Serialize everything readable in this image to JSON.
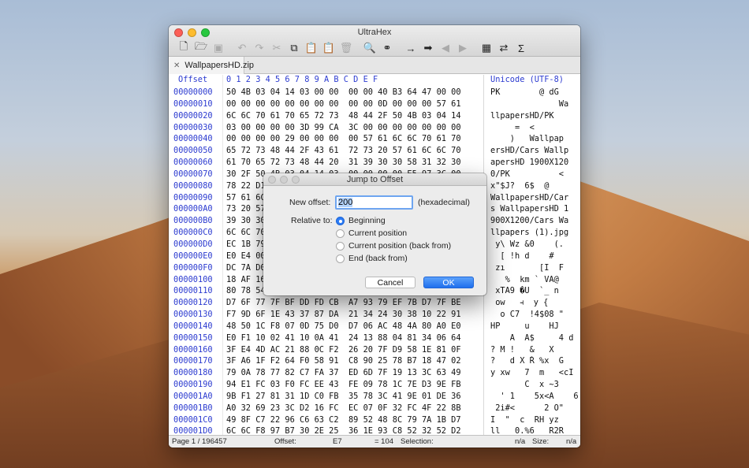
{
  "window": {
    "title": "UltraHex"
  },
  "toolbar": {
    "icons": [
      "new-document-icon",
      "open-folder-icon",
      "save-icon",
      "undo-icon",
      "redo-icon",
      "cut-icon",
      "copy-icon",
      "paste-icon",
      "paste-special-icon",
      "delete-icon",
      "find-icon",
      "binoculars-icon",
      "go-forward-icon",
      "jump-icon",
      "previous-icon",
      "next-icon",
      "columns-icon",
      "swap-icon",
      "sum-icon"
    ]
  },
  "tab": {
    "label": "WallpapersHD.zip"
  },
  "header": {
    "offset": "Offset",
    "hex_cols": "0  1  2  3  4  5  6  7   8  9  A  B  C  D  E  F",
    "unicode": "Unicode (UTF-8)"
  },
  "rows": [
    {
      "off": "00000000",
      "hex": "50 4B 03 04 14 03 00 00  00 00 40 B3 64 47 00 00",
      "txt": "PK        @ dG"
    },
    {
      "off": "00000010",
      "hex": "00 00 00 00 00 00 00 00  00 00 0D 00 00 00 57 61",
      "txt": "              Wa"
    },
    {
      "off": "00000020",
      "hex": "6C 6C 70 61 70 65 72 73  48 44 2F 50 4B 03 04 14",
      "txt": "llpapersHD/PK"
    },
    {
      "off": "00000030",
      "hex": "03 00 00 00 00 3D 99 CA  3C 00 00 00 00 00 00 00",
      "txt": "     =  <"
    },
    {
      "off": "00000040",
      "hex": "00 00 00 00 29 00 00 00  00 57 61 6C 6C 70 61 70",
      "txt": "    )   Wallpap"
    },
    {
      "off": "00000050",
      "hex": "65 72 73 48 44 2F 43 61  72 73 20 57 61 6C 6C 70",
      "txt": "ersHD/Cars Wallp"
    },
    {
      "off": "00000060",
      "hex": "61 70 65 72 73 48 44 20  31 39 30 30 58 31 32 30",
      "txt": "apersHD 1900X120"
    },
    {
      "off": "00000070",
      "hex": "30 2F 50 4B 03 04 14 03  00 00 00 00 E5 97 3C 00",
      "txt": "0/PK          <"
    },
    {
      "off": "00000080",
      "hex": "78 22 D1 3F 24 4A 3F 20  20 20 36 24 20 20 40 00",
      "txt": "x\"$J?  6$  @"
    },
    {
      "off": "00000090",
      "hex": "57 61 6C 6C 70 61 70 65  72 73 48 44 2F 43 61 72",
      "txt": "WallpapersHD/Car"
    },
    {
      "off": "000000A0",
      "hex": "73 20 57 61 6C 6C 70 61  70 65 72 73 48 44 20 31",
      "txt": "s WallpapersHD 1"
    },
    {
      "off": "000000B0",
      "hex": "39 30 30 58 31 32 30 30  2F 43 61 72 73 20 57 61",
      "txt": "900X1200/Cars Wa"
    },
    {
      "off": "000000C0",
      "hex": "6C 6C 70 61 70 65 72 73  20 28 31 29 2E 6A 70 67",
      "txt": "llpapers (1).jpg"
    },
    {
      "off": "000000D0",
      "hex": "EC 1B 79 5C 20 57 7A 20  26 30 20 20 20 20 28 2E",
      "txt": " y\\ Wz &0    (."
    },
    {
      "off": "000000E0",
      "hex": "E0 E4 00 5B 20 21 68 20  64 20 20 20 20 23 20 20",
      "txt": "  [ !h d    #"
    },
    {
      "off": "000000F0",
      "hex": "DC 7A D0 20 20 20 20 20  20 20 5B 49 20 20 46 20",
      "txt": " zı       [I  F"
    },
    {
      "off": "00000100",
      "hex": "18 AF 16 25 20 6B 6D 20  20 27 20 56 41 40 20 20",
      "txt": "   %  km ` VA@"
    },
    {
      "off": "00000110",
      "hex": "80 78 54 41 39 20 55 20  20 60 5F 20 6E 20 20 20",
      "txt": " xTA9 �U  `_ n"
    },
    {
      "off": "00000120",
      "hex": "D7 6F 77 7F BF DD FD CB  A7 93 79 EF 7B D7 7F BE",
      "txt": " ow   ⫞  y {"
    },
    {
      "off": "00000130",
      "hex": "F7 9D 6F 1E 43 37 87 DA  21 34 24 30 38 10 22 91",
      "txt": "  o C7  !4$08 \""
    },
    {
      "off": "00000140",
      "hex": "48 50 1C F8 07 0D 75 D0  D7 06 AC 48 4A 80 A0 E0",
      "txt": "HP     u    HJ"
    },
    {
      "off": "00000150",
      "hex": "E0 F1 10 02 41 10 0A 41  24 13 88 04 81 34 06 64",
      "txt": "    A  A$     4 d"
    },
    {
      "off": "00000160",
      "hex": "3F E4 4D AC 21 88 0C F2  26 20 7F D9 58 1E 81 0F",
      "txt": "? M !   &   X"
    },
    {
      "off": "00000170",
      "hex": "3F A6 1F F2 64 F0 58 91  C8 90 25 78 B7 18 47 02",
      "txt": "?   d X Ř %x  G"
    },
    {
      "off": "00000180",
      "hex": "79 0A 78 77 82 C7 FA 37  ED 6D 7F 19 13 3C 63 49",
      "txt": "y xw   7  m   <cI"
    },
    {
      "off": "00000190",
      "hex": "94 E1 FC 03 F0 FC EE 43  FE 09 78 1C 7E D3 9E FB",
      "txt": "       C  x ~Ӟ"
    },
    {
      "off": "000001A0",
      "hex": "9B F1 27 81 31 1D C0 FB  35 78 3C 41 9E 01 DE 36",
      "txt": "  ' 1    5x<A    6"
    },
    {
      "off": "000001B0",
      "hex": "A0 32 69 23 3C D2 16 FC  EC 07 0F 32 FC 4F 22 8B",
      "txt": " 2i#<      2 O\""
    },
    {
      "off": "000001C0",
      "hex": "49 8F C7 22 96 C6 63 C2  89 52 48 8C 79 7A 1B D7",
      "txt": "I  \"  c  RH yz"
    },
    {
      "off": "000001D0",
      "hex": "6C 6C F8 97 B7 30 2E 25  36 1E 93 C8 52 32 52 D2",
      "txt": "ll   0.%6   R2R"
    }
  ],
  "status": {
    "page": "Page 1 / 196457",
    "offset_label": "Offset:",
    "offset_value": "E7",
    "offset_dec": "= 104",
    "selection_label": "Selection:",
    "selection_value": "n/a",
    "size_label": "Size:",
    "size_value": "n/a"
  },
  "dialog": {
    "title": "Jump to Offset",
    "new_offset_label": "New offset:",
    "offset_value": "200",
    "hex_hint": "(hexadecimal)",
    "relative_label": "Relative to:",
    "options": [
      "Beginning",
      "Current position",
      "Current position (back from)",
      "End (back from)"
    ],
    "selected_option": "Beginning",
    "cancel": "Cancel",
    "ok": "OK"
  }
}
